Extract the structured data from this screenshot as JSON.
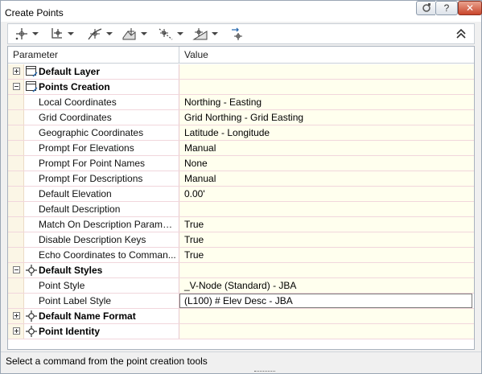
{
  "window": {
    "title": "Create Points",
    "controls": {
      "help": "?",
      "close": "✕"
    }
  },
  "toolbar": {
    "buttons": [
      {
        "name": "miscellaneous-points",
        "icon": "point-plus-icon"
      },
      {
        "name": "intersection-points",
        "icon": "point-intersection-icon"
      },
      {
        "name": "alignment-points",
        "icon": "alignment-point-icon"
      },
      {
        "name": "surface-points",
        "icon": "surface-point-icon"
      },
      {
        "name": "interpolate-points",
        "icon": "interpolate-point-icon"
      },
      {
        "name": "slope-points",
        "icon": "slope-point-icon"
      },
      {
        "name": "convert-points",
        "icon": "convert-point-icon"
      }
    ],
    "collapse_icon": "double-chevron-up-icon"
  },
  "grid": {
    "header": {
      "parameter": "Parameter",
      "value": "Value"
    },
    "rows": [
      {
        "type": "category",
        "expanded": false,
        "icon": "layer-icon",
        "label": "Default Layer",
        "value": ""
      },
      {
        "type": "category",
        "expanded": true,
        "icon": "layer-icon",
        "label": "Points Creation",
        "value": ""
      },
      {
        "type": "leaf",
        "label": "Local Coordinates",
        "value": "Northing - Easting"
      },
      {
        "type": "leaf",
        "label": "Grid Coordinates",
        "value": "Grid Northing - Grid Easting"
      },
      {
        "type": "leaf",
        "label": "Geographic Coordinates",
        "value": "Latitude - Longitude"
      },
      {
        "type": "leaf",
        "label": "Prompt For Elevations",
        "value": "Manual"
      },
      {
        "type": "leaf",
        "label": "Prompt For Point Names",
        "value": "None"
      },
      {
        "type": "leaf",
        "label": "Prompt For Descriptions",
        "value": "Manual"
      },
      {
        "type": "leaf",
        "label": "Default Elevation",
        "value": "0.00'"
      },
      {
        "type": "leaf",
        "label": "Default Description",
        "value": ""
      },
      {
        "type": "leaf",
        "label": "Match On Description Paramet...",
        "value": "True"
      },
      {
        "type": "leaf",
        "label": "Disable Description Keys",
        "value": "True"
      },
      {
        "type": "leaf",
        "label": "Echo Coordinates to Comman...",
        "value": "True"
      },
      {
        "type": "category",
        "expanded": true,
        "icon": "point-style-icon",
        "label": "Default Styles",
        "value": ""
      },
      {
        "type": "leaf",
        "label": "Point Style",
        "value": "_V-Node (Standard) - JBA"
      },
      {
        "type": "leaf",
        "label": "Point Label Style",
        "value": "(L100) # Elev Desc - JBA",
        "selected": true
      },
      {
        "type": "category",
        "expanded": false,
        "icon": "point-style-icon",
        "label": "Default Name Format",
        "value": ""
      },
      {
        "type": "category",
        "expanded": false,
        "icon": "point-style-icon",
        "label": "Point Identity",
        "value": ""
      }
    ]
  },
  "status": {
    "text": "Select a command from the point creation tools"
  },
  "colors": {
    "value_cell_bg": "#ffffee",
    "row_divider": "#f1d6dc",
    "close_button": "#c9452b"
  }
}
